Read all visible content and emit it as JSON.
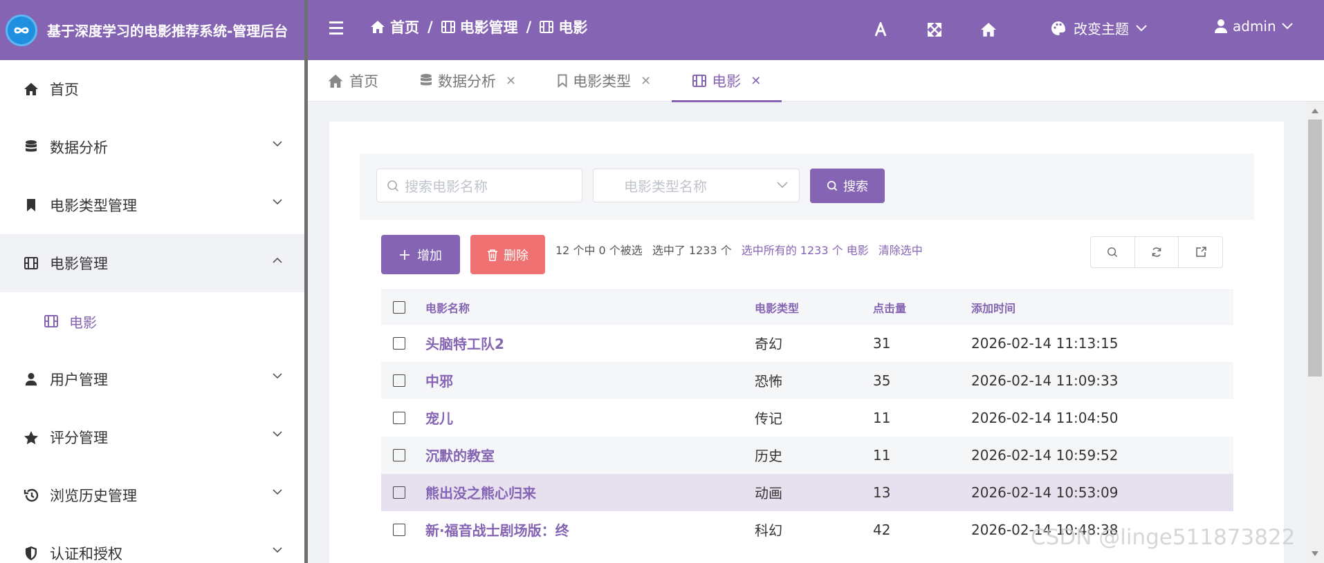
{
  "app": {
    "title": "基于深度学习的电影推荐系统-管理后台"
  },
  "topbar": {
    "breadcrumbs": [
      "首页",
      "电影管理",
      "电影"
    ],
    "theme_label": "改变主题",
    "user": "admin"
  },
  "sidebar": {
    "items": [
      {
        "label": "首页",
        "icon": "home-icon"
      },
      {
        "label": "数据分析",
        "icon": "database-icon"
      },
      {
        "label": "电影类型管理",
        "icon": "bookmark-icon"
      },
      {
        "label": "电影管理",
        "icon": "film-icon",
        "expanded": true
      },
      {
        "label": "用户管理",
        "icon": "user-icon"
      },
      {
        "label": "评分管理",
        "icon": "star-icon"
      },
      {
        "label": "浏览历史管理",
        "icon": "history-icon"
      },
      {
        "label": "认证和授权",
        "icon": "shield-icon"
      }
    ],
    "subitem": {
      "label": "电影",
      "icon": "film-icon"
    }
  },
  "tabs": [
    {
      "label": "首页",
      "closable": false
    },
    {
      "label": "数据分析",
      "closable": true
    },
    {
      "label": "电影类型",
      "closable": true
    },
    {
      "label": "电影",
      "closable": true,
      "active": true
    }
  ],
  "search": {
    "input_placeholder": "搜索电影名称",
    "select_placeholder": "电影类型名称",
    "button_label": "搜索"
  },
  "actions": {
    "add_label": "增加",
    "delete_label": "删除",
    "selection_count": "12 个中 0 个被选",
    "selected_total": "选中了 1233 个",
    "select_all_link": "选中所有的 1233 个 电影",
    "clear_link": "清除选中"
  },
  "table": {
    "headers": [
      "电影名称",
      "电影类型",
      "点击量",
      "添加时间"
    ],
    "rows": [
      {
        "name": "头脑特工队2",
        "type": "奇幻",
        "clicks": "31",
        "time": "2026-02-14 11:13:15"
      },
      {
        "name": "中邪",
        "type": "恐怖",
        "clicks": "35",
        "time": "2026-02-14 11:09:33"
      },
      {
        "name": "宠儿",
        "type": "传记",
        "clicks": "11",
        "time": "2026-02-14 11:04:50"
      },
      {
        "name": "沉默的教室",
        "type": "历史",
        "clicks": "11",
        "time": "2026-02-14 10:59:52"
      },
      {
        "name": "熊出没之熊心归来",
        "type": "动画",
        "clicks": "13",
        "time": "2026-02-14 10:53:09"
      },
      {
        "name": "新·福音战士剧场版：终",
        "type": "科幻",
        "clicks": "42",
        "time": "2026-02-14 10:48:38"
      }
    ]
  },
  "watermark": "CSDN @linge511873822",
  "colors": {
    "accent": "#8464b3",
    "danger": "#f07171",
    "highlight_row": "#e7e0ef"
  }
}
